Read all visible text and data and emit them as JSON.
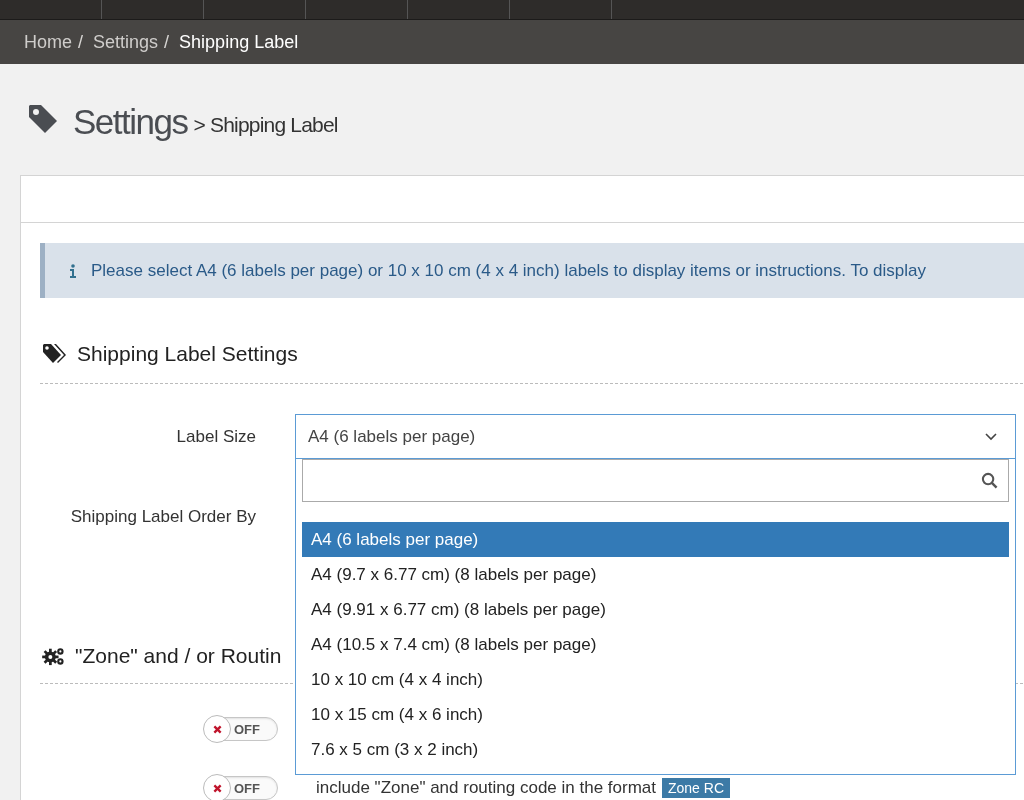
{
  "breadcrumb": [
    {
      "label": "Home",
      "current": false,
      "separator": "/"
    },
    {
      "label": "Settings",
      "current": false,
      "separator": "/"
    },
    {
      "label": "Shipping Label",
      "current": true
    }
  ],
  "page_title": {
    "title": "Settings",
    "subtitle": "> Shipping Label"
  },
  "info_alert": {
    "text": "Please select A4 (6 labels per page) or 10 x 10 cm (4 x 4 inch) labels to display items or instructions. To display"
  },
  "section_1": {
    "title": "Shipping Label Settings"
  },
  "label_size": {
    "label": "Label Size",
    "value": "A4 (6 labels per page)",
    "open": true,
    "options": [
      {
        "label": "A4 (6 labels per page)",
        "selected": true
      },
      {
        "label": "A4 (9.7 x 6.77 cm) (8 labels per page)",
        "selected": false
      },
      {
        "label": "A4 (9.91 x 6.77 cm) (8 labels per page)",
        "selected": false
      },
      {
        "label": "A4 (10.5 x 7.4 cm) (8 labels per page)",
        "selected": false
      },
      {
        "label": "10 x 10 cm (4 x 4 inch)",
        "selected": false
      },
      {
        "label": "10 x 15 cm (4 x 6 inch)",
        "selected": false
      },
      {
        "label": "7.6 x 5 cm (3 x 2 inch)",
        "selected": false
      }
    ]
  },
  "order_by": {
    "label": "Shipping Label Order By"
  },
  "section_2": {
    "title": "\"Zone\" and / or Routin"
  },
  "toggles": [
    {
      "state_label": "OFF",
      "on": false
    },
    {
      "state_label": "OFF",
      "on": false,
      "description": "include \"Zone\" and routing code in the format",
      "badge": "Zone RC"
    }
  ]
}
